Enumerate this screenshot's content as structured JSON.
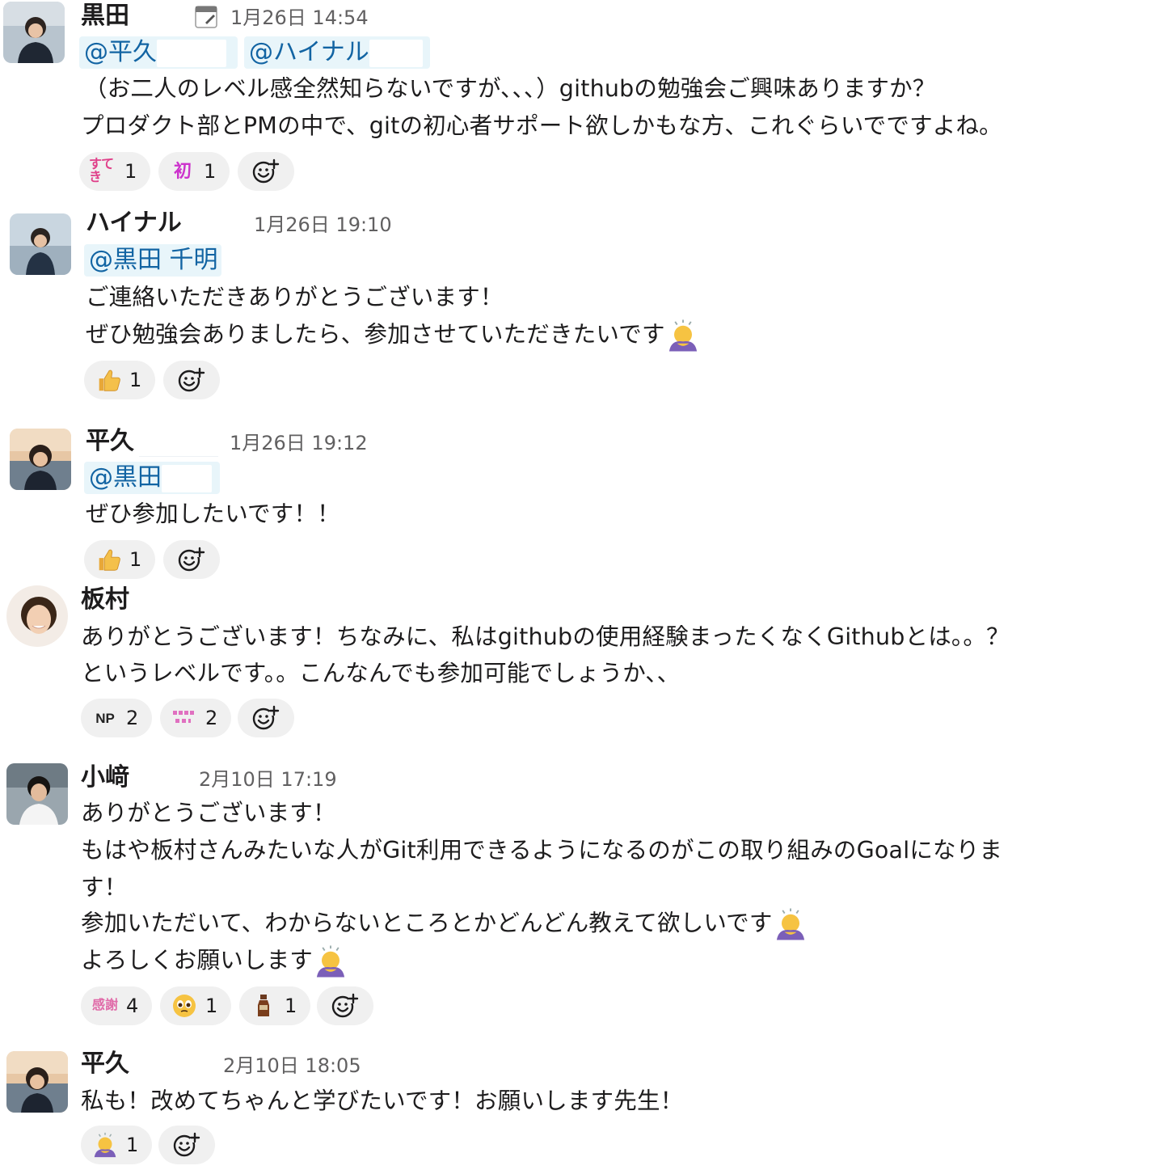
{
  "messages": [
    {
      "author": "黒田",
      "time": "1月26日 14:54",
      "mentions": [
        "@平久",
        "@ハイナル"
      ],
      "lines": [
        "（お二人のレベル感全然知らないですが､､､）githubの勉強会ご興味ありますか？",
        "プロダクト部とPMの中で、gitの初心者サポート欲しかもな方、これぐらいでですよね。"
      ],
      "reactions": [
        {
          "emoji": "sugoi-icon",
          "label": "すてき",
          "count": "1"
        },
        {
          "emoji": "maikai-icon",
          "label": "初",
          "count": "1"
        }
      ]
    },
    {
      "author": "ハイナル",
      "time": "1月26日 19:10",
      "mentions": [
        "@黒田 千明"
      ],
      "lines": [
        "ご連絡いただきありがとうございます！",
        "ぜひ勉強会ありましたら、参加させていただきたいです"
      ],
      "reactions": [
        {
          "emoji": "thumbs-up-icon",
          "count": "1"
        }
      ]
    },
    {
      "author": "平久",
      "time": "1月26日 19:12",
      "mentions": [
        "@黒田"
      ],
      "lines": [
        "ぜひ参加したいです！！"
      ],
      "reactions": [
        {
          "emoji": "thumbs-up-icon",
          "count": "1"
        }
      ]
    },
    {
      "author": "板村",
      "lines": [
        "ありがとうございます！ちなみに、私はgithubの使用経験まったくなくGithubとは。。？",
        "というレベルです。。こんなんでも参加可能でしょうか､､"
      ],
      "reactions": [
        {
          "emoji": "np-icon",
          "label": "NP",
          "count": "2"
        },
        {
          "emoji": "pink-text-icon",
          "count": "2"
        }
      ]
    },
    {
      "author": "小﨑",
      "time": "2月10日 17:19",
      "lines": [
        "ありがとうございます！",
        "もはや板村さんみたいな人がGit利用できるようになるのがこの取り組みのGoalになりま",
        "す！",
        "参加いただいて、わからないところとかどんどん教えて欲しいです",
        "よろしくお願いします"
      ],
      "reactions": [
        {
          "emoji": "kansha-icon",
          "label": "感謝",
          "count": "4"
        },
        {
          "emoji": "teary-face-icon",
          "count": "1"
        },
        {
          "emoji": "bottle-icon",
          "count": "1"
        }
      ]
    },
    {
      "author": "平久",
      "time": "2月10日 18:05",
      "lines": [
        "私も！改めてちゃんと学びたいです！お願いします先生！"
      ],
      "reactions": [
        {
          "emoji": "bowing-person-icon",
          "count": "1"
        }
      ]
    }
  ]
}
